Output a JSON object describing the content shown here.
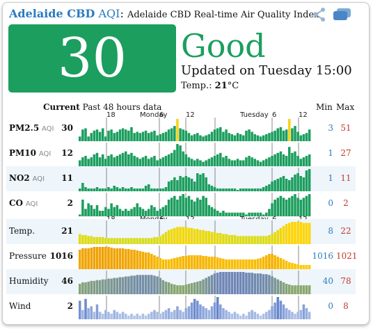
{
  "header": {
    "city": "Adelaide CBD",
    "aqi_label": "AQI",
    "colon": ":",
    "description": "Adelaide CBD Real-time Air Quality Index",
    "share_icon": "share-icon",
    "comment_icon": "comment-icon"
  },
  "summary": {
    "aqi_value": "30",
    "status": "Good",
    "updated": "Updated on Tuesday 15:00",
    "temp_label": "Temp.:",
    "temp_value": "21",
    "temp_unit": "°C",
    "status_color": "#1c9e5e"
  },
  "table": {
    "current_header": "Current",
    "history_header": "Past 48 hours data",
    "min_header": "Min",
    "max_header": "Max",
    "time_ticks": [
      "18",
      "Monday",
      "6",
      "12",
      "Tuesday",
      "6",
      "12"
    ],
    "rows": [
      {
        "name": "PM2.5",
        "unit": "AQI",
        "bold": true,
        "current": "30",
        "min": "3",
        "max": "51",
        "alt": false
      },
      {
        "name": "PM10",
        "unit": "AQI",
        "bold": true,
        "current": "12",
        "min": "1",
        "max": "27",
        "alt": false
      },
      {
        "name": "NO2",
        "unit": "AQI",
        "bold": true,
        "current": "11",
        "min": "1",
        "max": "11",
        "alt": true
      },
      {
        "name": "CO",
        "unit": "AQI",
        "bold": true,
        "current": "2",
        "min": "0",
        "max": "2",
        "alt": false
      },
      {
        "name": "Temp.",
        "unit": "",
        "bold": false,
        "current": "21",
        "min": "8",
        "max": "22",
        "alt": true
      },
      {
        "name": "Pressure",
        "unit": "",
        "bold": false,
        "current": "1016",
        "min": "1016",
        "max": "1021",
        "alt": false
      },
      {
        "name": "Humidity",
        "unit": "",
        "bold": false,
        "current": "46",
        "min": "40",
        "max": "78",
        "alt": true
      },
      {
        "name": "Wind",
        "unit": "",
        "bold": false,
        "current": "2",
        "min": "0",
        "max": "8",
        "alt": false
      }
    ]
  },
  "chart_data": {
    "type": "bar",
    "series": [
      {
        "name": "PM2.5",
        "color": "#1c9e5e",
        "highlight_color": "#f5d31b",
        "highlight_index": [
          34,
          73
        ],
        "values": [
          8,
          20,
          22,
          8,
          14,
          18,
          20,
          16,
          22,
          8,
          18,
          20,
          14,
          16,
          20,
          22,
          20,
          18,
          24,
          14,
          16,
          14,
          16,
          18,
          14,
          16,
          18,
          10,
          12,
          14,
          16,
          20,
          22,
          26,
          38,
          22,
          20,
          18,
          14,
          10,
          12,
          14,
          10,
          8,
          10,
          12,
          16,
          20,
          22,
          24,
          16,
          20,
          14,
          12,
          10,
          14,
          12,
          10,
          18,
          20,
          16,
          12,
          10,
          8,
          10,
          12,
          14,
          16,
          18,
          22,
          24,
          18,
          20,
          38,
          22,
          26,
          16,
          10,
          12,
          14,
          20
        ]
      },
      {
        "name": "PM10",
        "color": "#1c9e5e",
        "values": [
          8,
          12,
          14,
          10,
          12,
          16,
          18,
          12,
          16,
          10,
          14,
          16,
          12,
          14,
          16,
          18,
          20,
          16,
          18,
          14,
          12,
          10,
          12,
          14,
          10,
          12,
          14,
          8,
          10,
          12,
          14,
          16,
          18,
          22,
          30,
          28,
          20,
          16,
          12,
          10,
          8,
          10,
          8,
          6,
          8,
          10,
          12,
          14,
          16,
          18,
          12,
          14,
          10,
          8,
          8,
          10,
          8,
          8,
          12,
          14,
          12,
          10,
          8,
          6,
          8,
          10,
          12,
          14,
          16,
          18,
          20,
          16,
          14,
          26,
          18,
          20,
          14,
          10,
          12,
          14,
          16
        ]
      },
      {
        "name": "NO2",
        "color": "#1c9e5e",
        "values": [
          4,
          12,
          6,
          4,
          4,
          4,
          6,
          4,
          4,
          4,
          6,
          4,
          8,
          6,
          4,
          6,
          4,
          4,
          6,
          4,
          4,
          4,
          4,
          8,
          10,
          4,
          4,
          4,
          4,
          4,
          6,
          14,
          16,
          20,
          16,
          22,
          20,
          22,
          20,
          18,
          14,
          26,
          24,
          26,
          20,
          10,
          8,
          6,
          4,
          4,
          4,
          4,
          4,
          4,
          4,
          2,
          4,
          4,
          4,
          4,
          4,
          4,
          4,
          4,
          6,
          8,
          10,
          14,
          16,
          18,
          20,
          22,
          18,
          16,
          20,
          24,
          26,
          22,
          20,
          30,
          32
        ]
      },
      {
        "name": "CO",
        "color": "#1c9e5e",
        "values": [
          2,
          18,
          8,
          14,
          12,
          8,
          12,
          6,
          6,
          10,
          8,
          14,
          10,
          12,
          8,
          6,
          8,
          6,
          8,
          10,
          14,
          10,
          8,
          6,
          8,
          12,
          10,
          6,
          8,
          10,
          12,
          18,
          20,
          22,
          18,
          22,
          24,
          20,
          22,
          18,
          16,
          20,
          18,
          22,
          20,
          12,
          10,
          8,
          6,
          4,
          6,
          4,
          4,
          4,
          4,
          4,
          4,
          4,
          2,
          4,
          4,
          4,
          4,
          4,
          2,
          4,
          8,
          14,
          18,
          20,
          22,
          20,
          18,
          20,
          22,
          24,
          20,
          18,
          20,
          22,
          24
        ]
      },
      {
        "name": "Temp.",
        "color_low": "#c8e020",
        "color_high": "#ffd400",
        "values": [
          10,
          9,
          9,
          8,
          8,
          7,
          7,
          7,
          7,
          6,
          6,
          6,
          6,
          6,
          6,
          6,
          6,
          6,
          6,
          6,
          6,
          6,
          6,
          6,
          6,
          6,
          7,
          7,
          8,
          10,
          12,
          14,
          15,
          16,
          17,
          17,
          17,
          17,
          16,
          16,
          15,
          15,
          14,
          14,
          13,
          13,
          12,
          12,
          11,
          11,
          10,
          10,
          9,
          9,
          9,
          8,
          8,
          8,
          8,
          8,
          8,
          8,
          8,
          8,
          8,
          8,
          9,
          10,
          12,
          14,
          16,
          18,
          20,
          21,
          22,
          22,
          22,
          22,
          21,
          21,
          21
        ]
      },
      {
        "name": "Pressure",
        "color_low": "#ffd400",
        "color_high": "#f0a000",
        "values": [
          28,
          30,
          30,
          30,
          31,
          32,
          32,
          32,
          32,
          32,
          32,
          31,
          30,
          30,
          30,
          30,
          29,
          29,
          28,
          28,
          27,
          26,
          25,
          24,
          24,
          22,
          20,
          18,
          16,
          14,
          14,
          14,
          15,
          16,
          17,
          18,
          19,
          19,
          20,
          20,
          20,
          20,
          20,
          19,
          19,
          18,
          18,
          18,
          17,
          16,
          15,
          14,
          14,
          14,
          14,
          14,
          14,
          14,
          14,
          14,
          14,
          14,
          15,
          16,
          18,
          20,
          22,
          22,
          20,
          18,
          16,
          14,
          12,
          10,
          9,
          8,
          7,
          6,
          6,
          6,
          6
        ]
      },
      {
        "name": "Humidity",
        "color_low": "#9bbf3d",
        "color_high": "#6f86b5",
        "values": [
          14,
          16,
          16,
          17,
          18,
          18,
          19,
          19,
          20,
          20,
          21,
          21,
          22,
          22,
          23,
          23,
          24,
          24,
          25,
          25,
          26,
          26,
          26,
          26,
          26,
          26,
          25,
          24,
          22,
          19,
          17,
          16,
          14,
          13,
          12,
          12,
          12,
          13,
          14,
          15,
          16,
          17,
          18,
          20,
          22,
          24,
          26,
          28,
          29,
          30,
          30,
          30,
          30,
          30,
          30,
          30,
          30,
          30,
          29,
          29,
          29,
          28,
          28,
          28,
          27,
          27,
          26,
          24,
          22,
          20,
          18,
          16,
          14,
          13,
          12,
          12,
          12,
          12,
          12,
          12,
          12
        ]
      },
      {
        "name": "Wind",
        "color_low": "#c5d3f0",
        "color_high": "#6585cc",
        "values": [
          20,
          10,
          22,
          12,
          14,
          8,
          16,
          8,
          6,
          10,
          8,
          6,
          10,
          8,
          6,
          8,
          6,
          4,
          6,
          4,
          6,
          4,
          6,
          4,
          6,
          8,
          10,
          8,
          6,
          8,
          10,
          12,
          8,
          10,
          14,
          10,
          8,
          12,
          14,
          18,
          22,
          20,
          16,
          14,
          12,
          10,
          14,
          18,
          24,
          16,
          12,
          10,
          8,
          6,
          8,
          6,
          4,
          6,
          4,
          8,
          10,
          8,
          6,
          4,
          6,
          8,
          10,
          14,
          18,
          24,
          20,
          16,
          12,
          10,
          8,
          6,
          8,
          10,
          16,
          12,
          8
        ]
      }
    ]
  }
}
